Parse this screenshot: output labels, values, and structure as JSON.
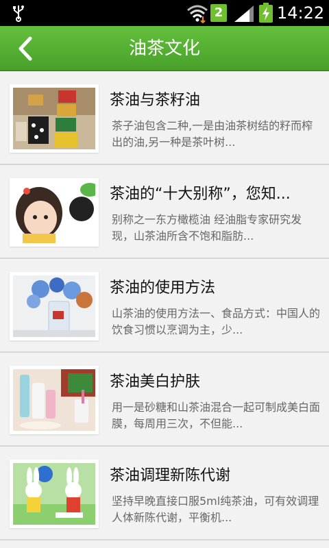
{
  "status_bar": {
    "time": "14:22",
    "sim_slot": "2",
    "icons": [
      "usb-icon",
      "wifi-icon",
      "sim-icon",
      "signal-icon",
      "battery-charging-icon"
    ]
  },
  "header": {
    "title": "油茶文化",
    "back_icon": "chevron-left-icon",
    "accent_color": "#52ad31"
  },
  "articles": [
    {
      "title": "茶油与茶籽油",
      "desc": "茶子油包含二种,一是由油茶树结的籽而榨出的油,另一种是茶叶树...",
      "image": "tea-cups-photo"
    },
    {
      "title": "茶油的“十大别称”，您知...",
      "desc": "别称之一东方橄榄油 经油脂专家研究发现，山茶油所含不饱和脂肪...",
      "image": "child-portrait-photo"
    },
    {
      "title": "茶油的使用方法",
      "desc": "山茶油的使用方法一、食品方式：中国人的饮食习惯以烹调为主，少...",
      "image": "flowers-glass-photo"
    },
    {
      "title": "茶油美白护肤",
      "desc": "用一是砂糖和山茶油混合一起可制成美白面膜，每周用三次，不但能...",
      "image": "skincare-bottles-photo"
    },
    {
      "title": "茶油调理新陈代谢",
      "desc": "坚持早晚直接口服5ml纯茶油，可有效调理人体新陈代谢，平衡机...",
      "image": "bunny-figurines-photo"
    }
  ]
}
